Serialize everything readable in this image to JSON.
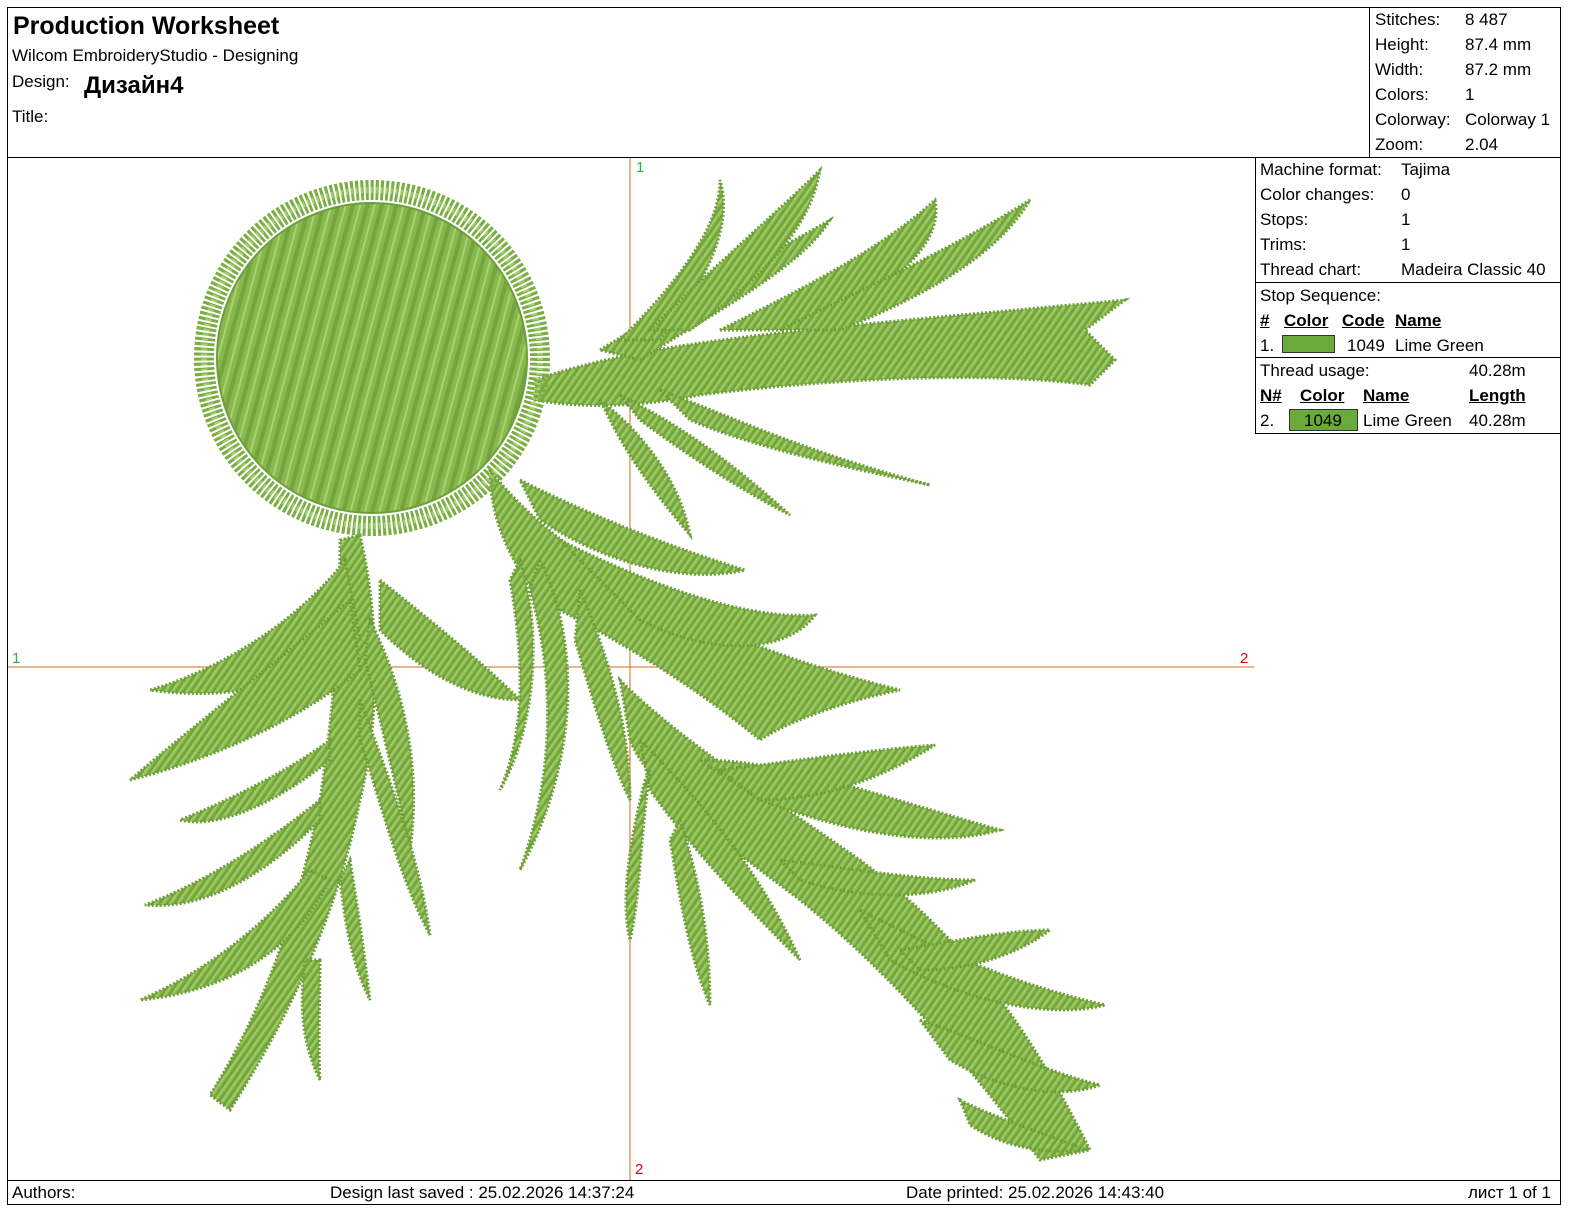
{
  "header": {
    "title": "Production Worksheet",
    "app": "Wilcom EmbroideryStudio - Designing",
    "design_label": "Design:",
    "design_name": "Дизайн4",
    "title_label": "Title:"
  },
  "summary": {
    "stitches_label": "Stitches:",
    "stitches": "8 487",
    "height_label": "Height:",
    "height": "87.4 mm",
    "width_label": "Width:",
    "width": "87.2 mm",
    "colors_label": "Colors:",
    "colors": "1",
    "colorway_label": "Colorway:",
    "colorway": "Colorway 1",
    "zoom_label": "Zoom:",
    "zoom": "2.04"
  },
  "machine": {
    "format_label": "Machine format:",
    "format": "Tajima",
    "color_changes_label": "Color changes:",
    "color_changes": "0",
    "stops_label": "Stops:",
    "stops": "1",
    "trims_label": "Trims:",
    "trims": "1",
    "thread_chart_label": "Thread chart:",
    "thread_chart": "Madeira Classic 40"
  },
  "stop_sequence": {
    "label": "Stop Sequence:",
    "headers": {
      "num": "#",
      "color": "Color",
      "code": "Code",
      "name": "Name"
    },
    "rows": [
      {
        "num": "1.",
        "color": "#6aaa3a",
        "code": "1049",
        "name": "Lime Green"
      }
    ]
  },
  "thread_usage": {
    "label": "Thread usage:",
    "total": "40.28m",
    "headers": {
      "num": "N#",
      "color": "Color",
      "name": "Name",
      "length": "Length"
    },
    "rows": [
      {
        "num": "2.",
        "color": "#6aaa3a",
        "code": "1049",
        "name": "Lime Green",
        "length": "40.28m"
      }
    ]
  },
  "canvas": {
    "x_axis_start": "1",
    "x_axis_end": "2",
    "y_axis_start": "1",
    "y_axis_end": "2",
    "thread_color": "#88b84e",
    "thread_dark": "#5f8f2e",
    "thread_light": "#b2d878"
  },
  "footer": {
    "authors": "Authors:",
    "saved": "Design last saved : 25.02.2026 14:37:24",
    "printed": "Date printed: 25.02.2026 14:43:40",
    "page": "лист 1 of 1"
  }
}
